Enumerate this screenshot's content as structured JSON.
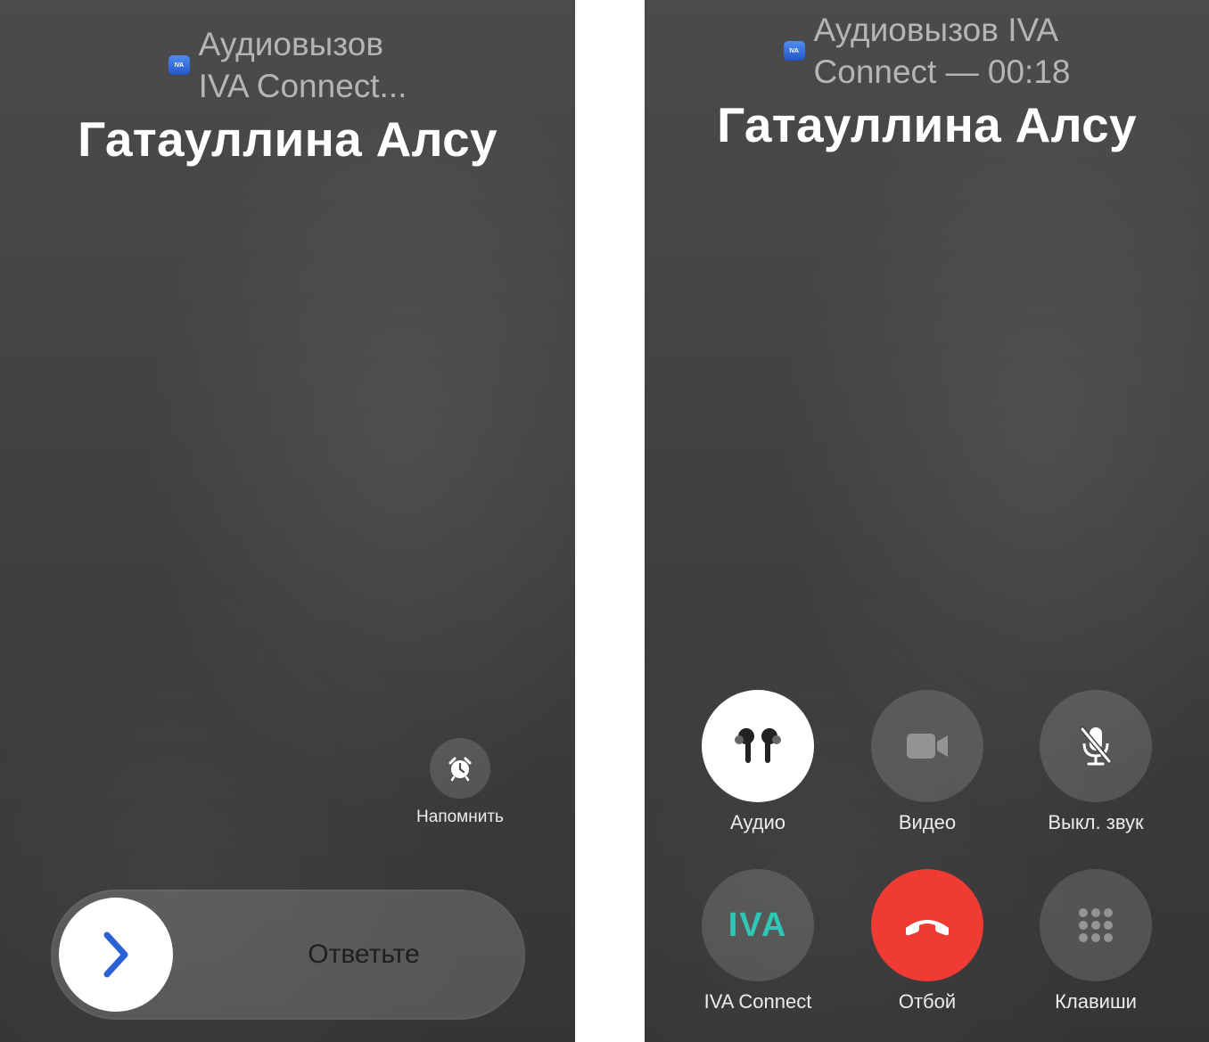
{
  "left_screen": {
    "subtitle": [
      "Аудиовызов",
      "IVA Connect..."
    ],
    "app_icon_label": "IVA",
    "caller_name": "Гатауллина Алсу",
    "remind": {
      "label": "Напомнить",
      "icon": "alarm-clock-icon"
    },
    "answer_slider": {
      "label": "Ответьте",
      "icon": "chevron-right-icon"
    }
  },
  "right_screen": {
    "subtitle": [
      "Аудиовызов IVA",
      "Connect — 00:18"
    ],
    "app_icon_label": "IVA",
    "caller_name": "Гатауллина Алсу",
    "controls": [
      {
        "label": "Аудио",
        "icon": "airpods-icon",
        "active": true
      },
      {
        "label": "Видео",
        "icon": "video-camera-icon",
        "active": false
      },
      {
        "label": "Выкл. звук",
        "icon": "microphone-slash-icon",
        "active": false
      },
      {
        "label": "IVA Connect",
        "icon": "iva-logo-icon",
        "logo_text": "IVA"
      },
      {
        "label": "Отбой",
        "icon": "hang-up-icon",
        "color": "#f03b35"
      },
      {
        "label": "Клавиши",
        "icon": "keypad-icon"
      }
    ]
  },
  "colors": {
    "background": "#3f3f3f",
    "end_call": "#f03b35",
    "accent_blue": "#2a62d6",
    "iva_teal": "#2fc7b6"
  }
}
